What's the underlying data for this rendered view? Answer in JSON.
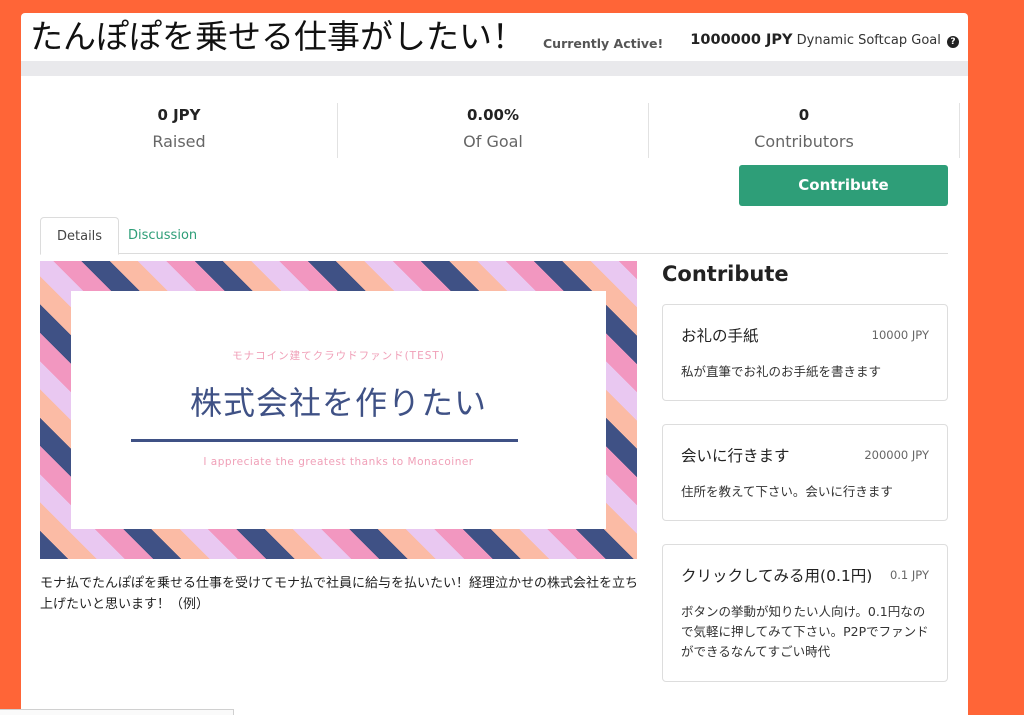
{
  "project": {
    "title": "たんぽぽを乗せる仕事がしたい！",
    "status": "Currently Active!",
    "goal_amount": "1000000 JPY",
    "goal_label": "Dynamic Softcap Goal",
    "goal_help_icon": "question-circle-icon"
  },
  "stats": [
    {
      "value": "0 JPY",
      "label": "Raised"
    },
    {
      "value": "0.00%",
      "label": "Of Goal"
    },
    {
      "value": "0",
      "label": "Contributors"
    }
  ],
  "contribute_button": "Contribute",
  "tabs": [
    {
      "label": "Details",
      "active": true
    },
    {
      "label": "Discussion",
      "active": false
    }
  ],
  "banner": {
    "subtitle": "モナコイン建てクラウドファンド(TEST)",
    "headline": "株式会社を作りたい",
    "thanks": "I appreciate the greatest thanks to Monacoiner"
  },
  "description": "モナ払でたんぽぽを乗せる仕事を受けてモナ払で社員に給与を払いたい！経理泣かせの株式会社を立ち上げたいと思います！（例）",
  "sidebar": {
    "title": "Contribute",
    "rewards": [
      {
        "name": "お礼の手紙",
        "price": "10000 JPY",
        "description": "私が直筆でお礼のお手紙を書きます"
      },
      {
        "name": "会いに行きます",
        "price": "200000 JPY",
        "description": "住所を教えて下さい。会いに行きます"
      },
      {
        "name": "クリックしてみる用(0.1円)",
        "price": "0.1 JPY",
        "description": "ボタンの挙動が知りたい人向け。0.1円なので気軽に押してみて下さい。P2Pでファンドができるなんてすごい時代"
      }
    ]
  },
  "colors": {
    "page_background": "#ff6537",
    "accent": "#2e9e78",
    "banner_navy": "#3f5185",
    "banner_pink": "#f297c0"
  }
}
